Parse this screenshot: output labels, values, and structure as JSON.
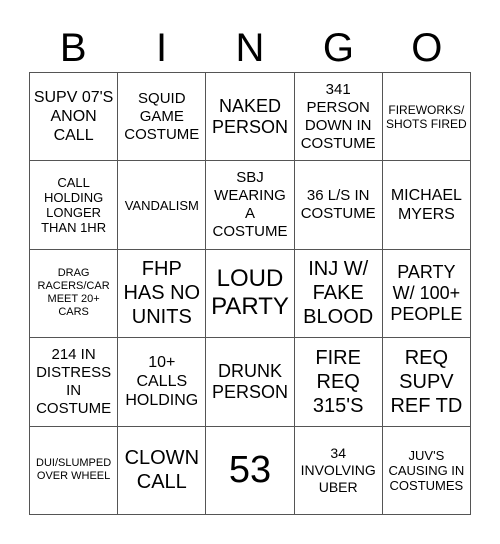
{
  "header": [
    "B",
    "I",
    "N",
    "G",
    "O"
  ],
  "cells": [
    "SUPV 07'S ANON CALL",
    "SQUID GAME COSTUME",
    "NAKED PERSON",
    "341 PERSON DOWN IN COSTUME",
    "FIREWORKS/ SHOTS FIRED",
    "CALL HOLDING LONGER THAN 1HR",
    "VANDALISM",
    "SBJ WEARING A COSTUME",
    "36 L/S IN COSTUME",
    "MICHAEL MYERS",
    "DRAG RACERS/CAR MEET 20+ CARS",
    "FHP HAS NO UNITS",
    "LOUD PARTY",
    "INJ W/ FAKE BLOOD",
    "PARTY W/ 100+ PEOPLE",
    "214 IN DISTRESS IN COSTUME",
    "10+ CALLS HOLDING",
    "DRUNK PERSON",
    "FIRE REQ 315'S",
    "REQ SUPV REF TD",
    "DUI/SLUMPED OVER WHEEL",
    "CLOWN CALL",
    "53",
    "34 INVOLVING UBER",
    "JUV'S CAUSING IN COSTUMES"
  ]
}
